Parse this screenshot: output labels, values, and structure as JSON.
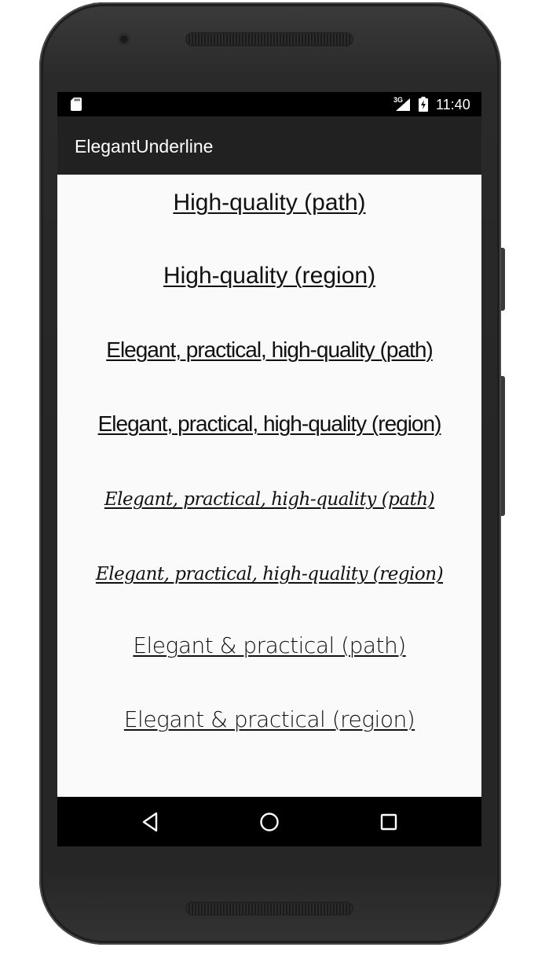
{
  "status_bar": {
    "network_type": "3G",
    "time": "11:40",
    "icons": [
      "sd-card-icon",
      "signal-icon",
      "battery-charging-icon"
    ]
  },
  "app_bar": {
    "title": "ElegantUnderline"
  },
  "items": [
    "High-quality (path)",
    "High-quality (region)",
    "Elegant, practical, high-quality (path)",
    "Elegant, practical, high-quality (region)",
    "Elegant, practical, high-quality (path)",
    "Elegant, practical, high-quality (region)",
    "Elegant & practical (path)",
    "Elegant & practical (region)"
  ],
  "nav_bar": {
    "icons": [
      "back-icon",
      "home-icon",
      "recent-apps-icon"
    ]
  },
  "colors": {
    "status_bar": "#000000",
    "app_bar": "#212121",
    "background": "#fafafa",
    "text": "#111111"
  }
}
